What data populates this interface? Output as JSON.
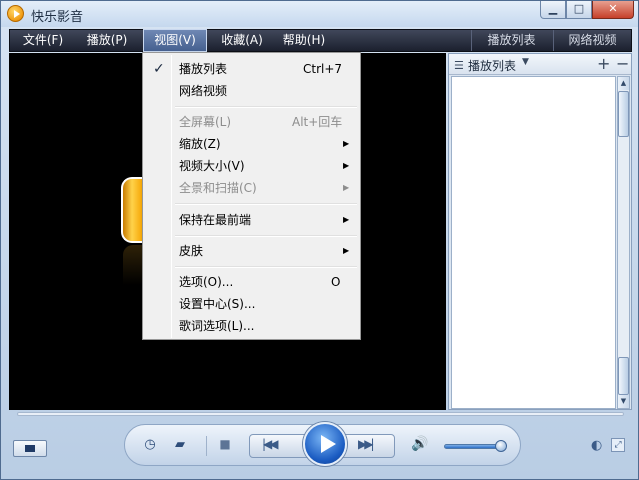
{
  "window": {
    "title": "快乐影音",
    "min_label": "▁",
    "max_label": "□",
    "close_label": "✕"
  },
  "menubar": {
    "items": [
      "文件(F)",
      "播放(P)",
      "视图(V)",
      "收藏(A)",
      "帮助(H)"
    ],
    "right_tabs": [
      "播放列表",
      "网络视频"
    ]
  },
  "view_menu": {
    "items": [
      {
        "label": "播放列表",
        "shortcut": "Ctrl+7",
        "checked": true,
        "enabled": true,
        "submenu": false
      },
      {
        "label": "网络视频",
        "shortcut": "",
        "checked": false,
        "enabled": true,
        "submenu": false
      },
      {
        "label": "全屏幕(L)",
        "shortcut": "Alt+回车",
        "checked": false,
        "enabled": false,
        "submenu": false
      },
      {
        "label": "缩放(Z)",
        "shortcut": "",
        "checked": false,
        "enabled": true,
        "submenu": true
      },
      {
        "label": "视频大小(V)",
        "shortcut": "",
        "checked": false,
        "enabled": true,
        "submenu": true
      },
      {
        "label": "全景和扫描(C)",
        "shortcut": "",
        "checked": false,
        "enabled": false,
        "submenu": true
      },
      {
        "label": "保持在最前端",
        "shortcut": "",
        "checked": false,
        "enabled": true,
        "submenu": true
      },
      {
        "label": "皮肤",
        "shortcut": "",
        "checked": false,
        "enabled": true,
        "submenu": true
      },
      {
        "label": "选项(O)...",
        "shortcut": "O",
        "checked": false,
        "enabled": true,
        "submenu": false
      },
      {
        "label": "设置中心(S)...",
        "shortcut": "",
        "checked": false,
        "enabled": true,
        "submenu": false
      },
      {
        "label": "歌词选项(L)...",
        "shortcut": "",
        "checked": false,
        "enabled": true,
        "submenu": false
      }
    ],
    "check_glyph": "✓",
    "arrow_glyph": "▶"
  },
  "playlist": {
    "title": "播放列表",
    "add_label": "+",
    "remove_label": "−",
    "list_glyph": "☰",
    "caret_glyph": "▼"
  },
  "controls": {
    "volume_level": 0.95,
    "icons": [
      "timer-icon",
      "folder-icon",
      "stop-icon",
      "previous-icon",
      "play-icon",
      "next-icon",
      "volume-icon"
    ]
  },
  "colors": {
    "accent": "#1b5cc2",
    "menubar": "#1b202e",
    "video_bg": "#000000"
  }
}
